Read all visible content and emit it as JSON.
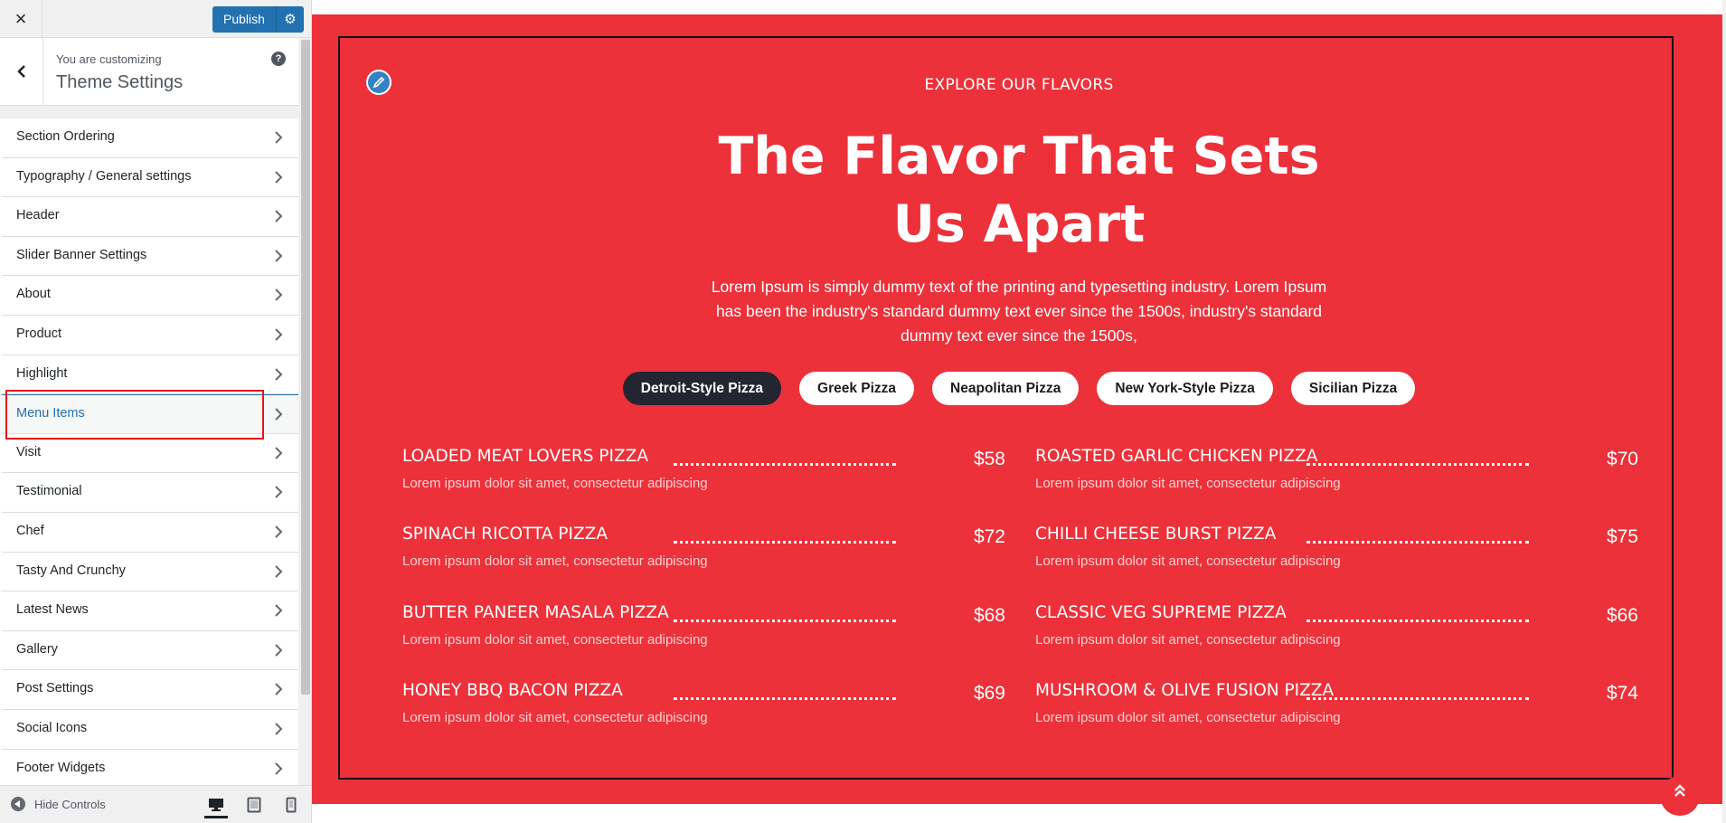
{
  "header": {
    "close_label": "×",
    "publish_label": "Publish"
  },
  "info": {
    "customizing_label": "You are customizing",
    "theme_title": "Theme Settings",
    "help_label": "?"
  },
  "panels": [
    {
      "label": "Section Ordering",
      "active": false
    },
    {
      "label": "Typography / General settings",
      "active": false
    },
    {
      "label": "Header",
      "active": false
    },
    {
      "label": "Slider Banner Settings",
      "active": false
    },
    {
      "label": "About",
      "active": false
    },
    {
      "label": "Product",
      "active": false
    },
    {
      "label": "Highlight",
      "active": false
    },
    {
      "label": "Menu Items",
      "active": true
    },
    {
      "label": "Visit",
      "active": false
    },
    {
      "label": "Testimonial",
      "active": false
    },
    {
      "label": "Chef",
      "active": false
    },
    {
      "label": "Tasty And Crunchy",
      "active": false
    },
    {
      "label": "Latest News",
      "active": false
    },
    {
      "label": "Gallery",
      "active": false
    },
    {
      "label": "Post Settings",
      "active": false
    },
    {
      "label": "Social Icons",
      "active": false
    },
    {
      "label": "Footer Widgets",
      "active": false
    }
  ],
  "footer": {
    "hide_controls_label": "Hide Controls",
    "devices": [
      "desktop-icon",
      "tablet-icon",
      "mobile-icon"
    ]
  },
  "preview": {
    "eyebrow": "EXPLORE OUR FLAVORS",
    "heading_line1": "The Flavor That Sets",
    "heading_line2": "Us Apart",
    "intro": "Lorem Ipsum is simply dummy text of the printing and typesetting industry. Lorem Ipsum has been the industry's standard dummy text ever since the 1500s, industry's standard dummy text ever since the 1500s,",
    "tabs": [
      {
        "label": "Detroit-Style Pizza",
        "active": true
      },
      {
        "label": "Greek Pizza",
        "active": false
      },
      {
        "label": "Neapolitan Pizza",
        "active": false
      },
      {
        "label": "New York-Style Pizza",
        "active": false
      },
      {
        "label": "Sicilian Pizza",
        "active": false
      }
    ],
    "menu_items": [
      {
        "name": "LOADED MEAT LOVERS PIZZA",
        "price": "$58",
        "desc": "Lorem ipsum dolor sit amet, consectetur adipiscing"
      },
      {
        "name": "ROASTED GARLIC CHICKEN PIZZA",
        "price": "$70",
        "desc": "Lorem ipsum dolor sit amet, consectetur adipiscing"
      },
      {
        "name": "SPINACH RICOTTA PIZZA",
        "price": "$72",
        "desc": "Lorem ipsum dolor sit amet, consectetur adipiscing"
      },
      {
        "name": "CHILLI CHEESE BURST PIZZA",
        "price": "$75",
        "desc": "Lorem ipsum dolor sit amet, consectetur adipiscing"
      },
      {
        "name": "BUTTER PANEER MASALA PIZZA",
        "price": "$68",
        "desc": "Lorem ipsum dolor sit amet, consectetur adipiscing"
      },
      {
        "name": "CLASSIC VEG SUPREME PIZZA",
        "price": "$66",
        "desc": "Lorem ipsum dolor sit amet, consectetur adipiscing"
      },
      {
        "name": "HONEY BBQ BACON PIZZA",
        "price": "$69",
        "desc": "Lorem ipsum dolor sit amet, consectetur adipiscing"
      },
      {
        "name": "MUSHROOM & OLIVE FUSION PIZZA",
        "price": "$74",
        "desc": "Lorem ipsum dolor sit amet, consectetur adipiscing"
      }
    ]
  },
  "colors": {
    "accent_red": "#ec313a",
    "wp_blue": "#2271b1",
    "dark_tab": "#232631"
  }
}
